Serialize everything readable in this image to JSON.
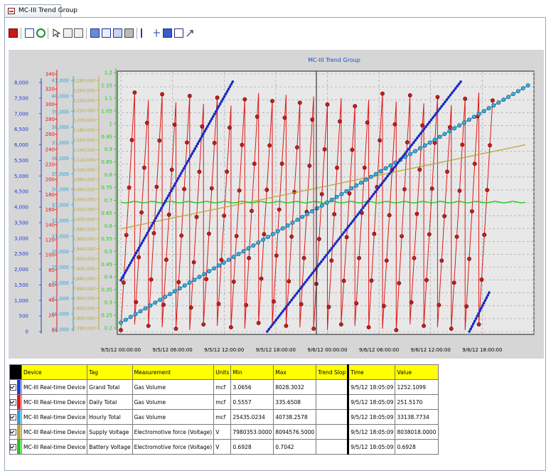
{
  "window": {
    "tab_title": "MC-III Trend Group"
  },
  "toolbar": {
    "icons": [
      "close-icon",
      "properties-icon",
      "refresh-icon",
      "pointer-icon",
      "zoom-in-icon",
      "zoom-out-icon",
      "save-icon",
      "export-icon",
      "copy-icon",
      "print-icon",
      "scale-icon",
      "cursor-icon",
      "data-grid-icon",
      "chart-type-icon",
      "marker-icon"
    ]
  },
  "chart_data": {
    "type": "line",
    "title": "MC-III Trend Group",
    "x_ticks": [
      "9/5/12 00:00:00",
      "9/5/12 06:00:00",
      "9/5/12 12:00:00",
      "9/5/12 18:00:00",
      "9/6/12 00:00:00",
      "9/6/12 06:00:00",
      "9/6/12 12:00:00",
      "9/6/12 18:00:00"
    ],
    "y_axes": [
      {
        "name": "Grand Total",
        "color": "#1e3ad8",
        "ticks": [
          "8,000",
          "7,500",
          "7,000",
          "6,500",
          "6,000",
          "5,500",
          "5,000",
          "4,500",
          "4,000",
          "3,500",
          "3,000",
          "2,500",
          "2,000",
          "1,500",
          "1,000",
          "500",
          "0"
        ]
      },
      {
        "name": "Daily Total",
        "color": "#e01818",
        "ticks": [
          "340",
          "320",
          "300",
          "280",
          "260",
          "240",
          "220",
          "200",
          "180",
          "160",
          "140",
          "120",
          "100",
          "80",
          "60",
          "40",
          "20",
          "0"
        ]
      },
      {
        "name": "Hourly Total",
        "color": "#2aa0d8",
        "ticks": [
          "41,000",
          "40,000",
          "39,000",
          "38,000",
          "37,000",
          "36,000",
          "35,000",
          "34,000",
          "33,000",
          "32,000",
          "31,000",
          "30,000",
          "29,000",
          "28,000",
          "27,000",
          "26,000",
          "25,000"
        ]
      },
      {
        "name": "Supply Voltage",
        "color": "#b8a838",
        "ticks": [
          "8,280,000",
          "8,260,000",
          "8,240,000",
          "8,220,000",
          "8,200,000",
          "8,180,000",
          "8,160,000",
          "8,140,000",
          "8,120,000",
          "8,100,000",
          "8,080,000",
          "8,060,000",
          "8,040,000",
          "8,020,000",
          "8,000,000",
          "7,980,000",
          "7,960,000",
          "7,940,000",
          "7,920,000",
          "7,900,000",
          "7,880,000",
          "7,860,000",
          "7,840,000",
          "7,820,000",
          "7,800,000",
          "7,780,000"
        ]
      },
      {
        "name": "Battery Voltage",
        "color": "#22c81e",
        "ticks": [
          "1.2",
          "1.15",
          "1.1",
          "1.05",
          "1",
          "0.95",
          "0.9",
          "0.85",
          "0.8",
          "0.75",
          "0.7",
          "0.65",
          "0.6",
          "0.55",
          "0.5",
          "0.45",
          "0.4",
          "0.35",
          "0.3",
          "0.25",
          "0.2"
        ]
      }
    ],
    "series": [
      {
        "name": "Grand Total",
        "color": "#1e3ad8",
        "x_hours": [
          0,
          13,
          17,
          36,
          40,
          42
        ],
        "values": [
          1650,
          8028,
          0,
          8028,
          0,
          1252
        ]
      },
      {
        "name": "Daily Total",
        "color": "#e01818",
        "pattern": "sawtooth",
        "min": 0.5557,
        "max": 335.6508
      },
      {
        "name": "Hourly Total",
        "color": "#2aa0d8",
        "x_hours": [
          0,
          42
        ],
        "values": [
          25435,
          40738
        ]
      },
      {
        "name": "Supply Voltage",
        "color": "#b8a838",
        "x_hours": [
          0,
          42
        ],
        "values": [
          7980353,
          8094576
        ]
      },
      {
        "name": "Battery Voltage",
        "color": "#22c81e",
        "x_hours": [
          0,
          42
        ],
        "values": [
          0.6928,
          0.6928
        ]
      }
    ]
  },
  "legend": {
    "headers": [
      "Device",
      "Tag",
      "Measurement",
      "Units",
      "Min",
      "Max",
      "Trend Slop",
      "Time",
      "Value"
    ],
    "rows": [
      {
        "color": "#1e3ad8",
        "device": "MC-III Real-time Device",
        "tag": "Grand Total",
        "measurement": "Gas Volume",
        "units": "mcf",
        "min": "3.0656",
        "max": "8028.3032",
        "slope": "",
        "time": "9/5/12  18:05:09",
        "value": "1252.1099"
      },
      {
        "color": "#e01818",
        "device": "MC-III Real-time Device",
        "tag": "Daily Total",
        "measurement": "Gas Volume",
        "units": "mcf",
        "min": "0.5557",
        "max": "335.6508",
        "slope": "",
        "time": "9/5/12  18:05:09",
        "value": "251.5170"
      },
      {
        "color": "#2aa0d8",
        "device": "MC-III Real-time Device",
        "tag": "Hourly Total",
        "measurement": "Gas Volume",
        "units": "mcf",
        "min": "25435.0234",
        "max": "40738.2578",
        "slope": "",
        "time": "9/5/12  18:05:09",
        "value": "33138.7734"
      },
      {
        "color": "#b8a838",
        "device": "MC-III Real-time Device",
        "tag": "Supply Voltage",
        "measurement": "Electromotive force (Voltage)",
        "units": "V",
        "min": "7980353.0000",
        "max": "8094576.5000",
        "slope": "",
        "time": "9/5/12  18:05:09",
        "value": "8038018.0000"
      },
      {
        "color": "#22c81e",
        "device": "MC-III Real-time Device",
        "tag": "Battery Voltage",
        "measurement": "Electromotive force (Voltage)",
        "units": "V",
        "min": "0.6928",
        "max": "0.7042",
        "slope": "",
        "time": "9/5/12  18:05:09",
        "value": "0.6928"
      }
    ]
  }
}
